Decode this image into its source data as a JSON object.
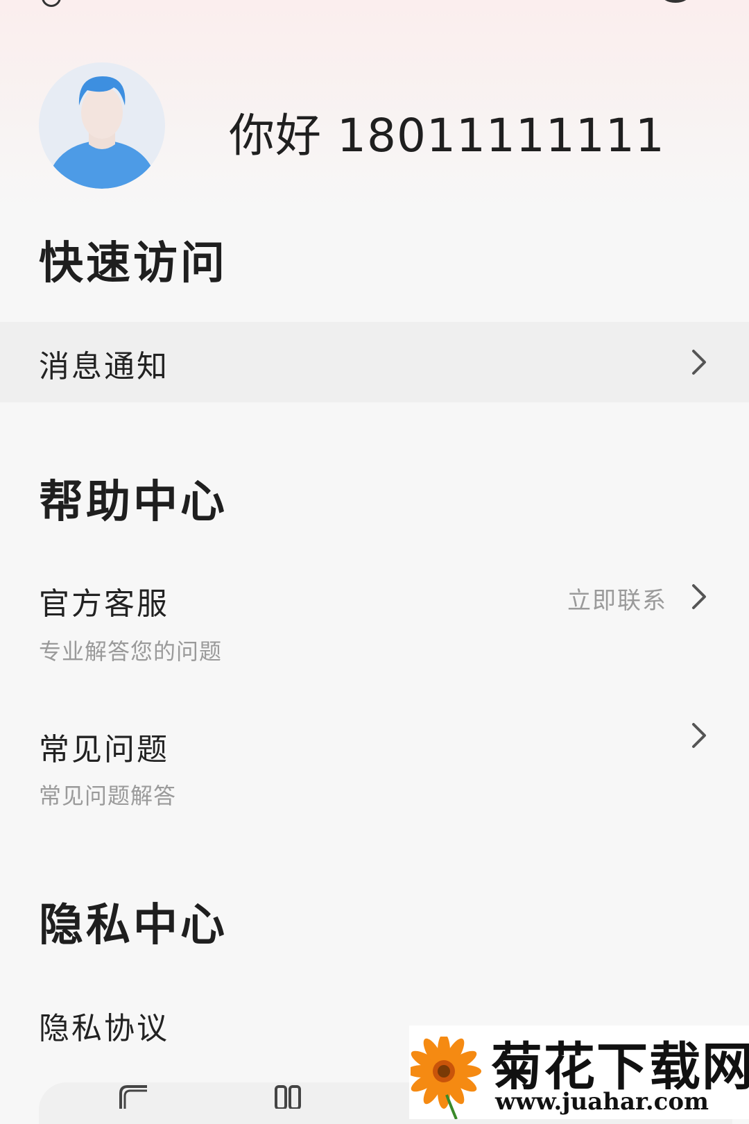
{
  "profile": {
    "greeting": "你好 18011111111"
  },
  "quick_access": {
    "title": "快速访问",
    "items": [
      {
        "label": "消息通知"
      }
    ]
  },
  "help_center": {
    "title": "帮助中心",
    "items": [
      {
        "label": "官方客服",
        "subtitle": "专业解答您的问题",
        "action": "立即联系"
      },
      {
        "label": "常见问题",
        "subtitle": "常见问题解答"
      }
    ]
  },
  "privacy_center": {
    "title": "隐私中心",
    "items": [
      {
        "label": "隐私协议"
      }
    ]
  },
  "icons": {
    "top_left": "notification-icon",
    "top_right_1": "scan-icon",
    "top_right_2": "settings-icon",
    "chevron": "chevron-right-icon"
  },
  "watermark": {
    "title": "菊花下载网",
    "url": "www.juahar.com"
  },
  "colors": {
    "accent_avatar": "#4a90e2",
    "highlight_row": "#efefef",
    "secondary_text": "#9a9a9a"
  }
}
